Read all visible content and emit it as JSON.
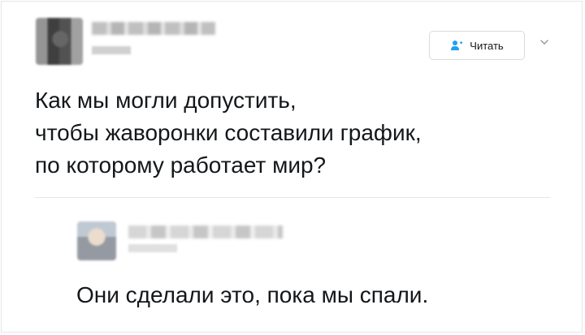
{
  "author": {
    "avatar": "blurred-avatar"
  },
  "follow_button": {
    "label": "Читать",
    "icon": "follow-person-icon"
  },
  "menu": {
    "icon": "chevron-down-icon"
  },
  "tweet": {
    "text": "Как мы могли допустить,\nчтобы жаворонки составили график,\nпо которому работает мир?"
  },
  "reply": {
    "avatar": "blurred-avatar",
    "text": "Они сделали это, пока мы спали."
  },
  "colors": {
    "text": "#14171a",
    "accent": "#1da1f2",
    "border": "#e1e8ed"
  }
}
